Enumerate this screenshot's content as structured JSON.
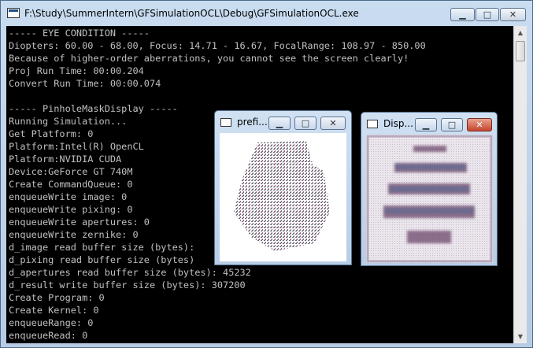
{
  "window": {
    "title": "F:\\Study\\SummerIntern\\GFSimulationOCL\\Debug\\GFSimulationOCL.exe",
    "minimize_glyph": "▁",
    "maximize_glyph": "□",
    "close_glyph": "✕"
  },
  "console": {
    "lines": [
      "----- EYE CONDITION -----",
      "Diopters: 60.00 - 68.00, Focus: 14.71 - 16.67, FocalRange: 108.97 - 850.00",
      "Because of higher-order aberrations, you cannot see the screen clearly!",
      "Proj Run Time: 00:00.204",
      "Convert Run Time: 00:00.074",
      "",
      "----- PinholeMaskDisplay -----",
      "Running Simulation...",
      "Get Platform: 0",
      "Platform:Intel(R) OpenCL",
      "Platform:NVIDIA CUDA",
      "Device:GeForce GT 740M",
      "Create CommandQueue: 0",
      "enqueueWrite image: 0",
      "enqueueWrite pixing: 0",
      "enqueueWrite apertures: 0",
      "enqueueWrite zernike: 0",
      "d_image read buffer size (bytes):",
      "d_pixing read buffer size (bytes)",
      "d_apertures read buffer size (bytes): 45232",
      "d_result write buffer size (bytes): 307200",
      "Create Program: 0",
      "Create Kernel: 0",
      "enqueueRange: 0",
      "enqueueRead: 0"
    ]
  },
  "prefilter_window": {
    "title": "prefi..."
  },
  "display_window": {
    "title": "Disp..."
  },
  "icons": {
    "app": "console-app-icon",
    "scroll_up": "▲",
    "scroll_down": "▼"
  },
  "colors": {
    "console_bg": "#000000",
    "console_text": "#c0c0c0",
    "close_button": "#c4442d"
  }
}
